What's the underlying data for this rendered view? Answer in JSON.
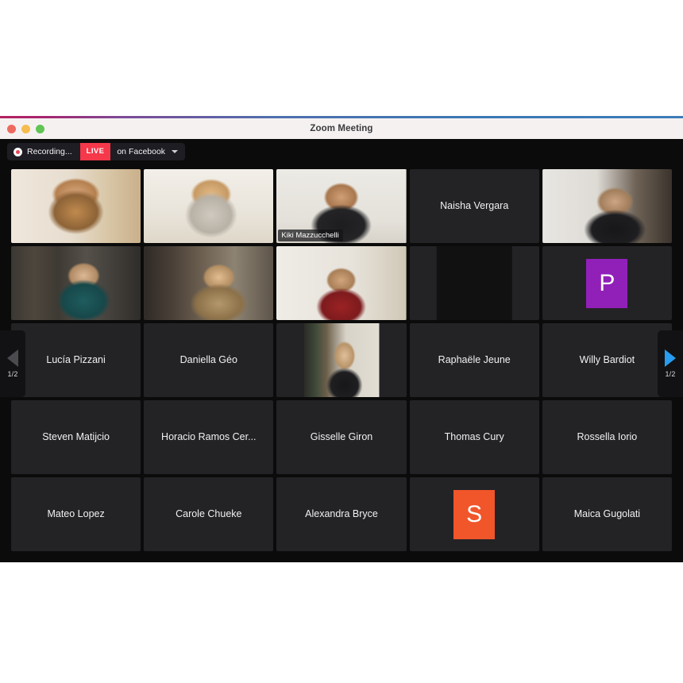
{
  "window": {
    "title": "Zoom Meeting",
    "traffic_lights": [
      "close-button",
      "minimize-button",
      "maximize-button"
    ]
  },
  "toolbar": {
    "recording_label": "Recording...",
    "recording_icon": "record-dot-icon",
    "live_badge": "LIVE",
    "platform_label": "on Facebook",
    "dropdown_icon": "chevron-down-icon"
  },
  "nav": {
    "prev_icon": "triangle-left-icon",
    "next_icon": "triangle-right-icon",
    "prev_count": "1/2",
    "next_count": "1/2",
    "prev_active": false,
    "next_active": true
  },
  "colors": {
    "live_red": "#f5384a",
    "speaking_border": "#c9e265",
    "avatar_purple": "#9020b8",
    "avatar_orange": "#f1552a",
    "next_arrow_blue": "#279cf0",
    "prev_arrow_gray": "#4a4a4f",
    "window_background": "#0b0b0b",
    "tile_background": "#232326"
  },
  "grid": {
    "columns": 5,
    "rows": 5,
    "tiles": [
      {
        "id": "t1",
        "kind": "video",
        "name": "",
        "label_visible": false,
        "speaking": false,
        "inset": false,
        "art": "woman-yellow-top-window"
      },
      {
        "id": "t2",
        "kind": "video",
        "name": "",
        "label_visible": false,
        "speaking": false,
        "inset": false,
        "art": "blonde-woman-hand-on-cheek"
      },
      {
        "id": "t3",
        "kind": "video",
        "name": "Kiki Mazzucchelli",
        "label_visible": true,
        "speaking": true,
        "inset": false,
        "art": "woman-black-top-white-wall"
      },
      {
        "id": "t4",
        "kind": "name",
        "name": "Naisha Vergara",
        "label_visible": true,
        "speaking": false,
        "inset": false,
        "art": ""
      },
      {
        "id": "t5",
        "kind": "video",
        "name": "",
        "label_visible": false,
        "speaking": false,
        "inset": false,
        "art": "person-with-headphones"
      },
      {
        "id": "t6",
        "kind": "video",
        "name": "",
        "label_visible": false,
        "speaking": false,
        "inset": false,
        "art": "woman-bookshelf-teal"
      },
      {
        "id": "t7",
        "kind": "video",
        "name": "",
        "label_visible": false,
        "speaking": false,
        "inset": false,
        "art": "man-glasses-library"
      },
      {
        "id": "t8",
        "kind": "video",
        "name": "",
        "label_visible": false,
        "speaking": false,
        "inset": false,
        "art": "woman-red-turtleneck"
      },
      {
        "id": "t9",
        "kind": "photo",
        "name": "",
        "label_visible": false,
        "speaking": false,
        "inset": true,
        "art": "sunset-yoga-silhouette"
      },
      {
        "id": "t10",
        "kind": "avatar",
        "name": "",
        "label_visible": false,
        "speaking": false,
        "inset": false,
        "art": "",
        "initial": "P",
        "avatar_color": "#9020b8"
      },
      {
        "id": "t11",
        "kind": "name",
        "name": "Lucía Pizzani",
        "label_visible": true,
        "speaking": false,
        "inset": false,
        "art": ""
      },
      {
        "id": "t12",
        "kind": "name",
        "name": "Daniella Géo",
        "label_visible": true,
        "speaking": false,
        "inset": false,
        "art": ""
      },
      {
        "id": "t13",
        "kind": "video",
        "name": "",
        "label_visible": false,
        "speaking": false,
        "inset": true,
        "art": "person-glasses-bookshelf"
      },
      {
        "id": "t14",
        "kind": "name",
        "name": "Raphaële Jeune",
        "label_visible": true,
        "speaking": false,
        "inset": false,
        "art": ""
      },
      {
        "id": "t15",
        "kind": "name",
        "name": "Willy Bardiot",
        "label_visible": true,
        "speaking": false,
        "inset": false,
        "art": ""
      },
      {
        "id": "t16",
        "kind": "name",
        "name": "Steven Matijcio",
        "label_visible": true,
        "speaking": false,
        "inset": false,
        "art": ""
      },
      {
        "id": "t17",
        "kind": "name",
        "name": "Horacio Ramos Cer...",
        "label_visible": true,
        "speaking": false,
        "inset": false,
        "art": ""
      },
      {
        "id": "t18",
        "kind": "name",
        "name": "Gisselle Giron",
        "label_visible": true,
        "speaking": false,
        "inset": false,
        "art": ""
      },
      {
        "id": "t19",
        "kind": "name",
        "name": "Thomas Cury",
        "label_visible": true,
        "speaking": false,
        "inset": false,
        "art": ""
      },
      {
        "id": "t20",
        "kind": "name",
        "name": "Rossella Iorio",
        "label_visible": true,
        "speaking": false,
        "inset": false,
        "art": ""
      },
      {
        "id": "t21",
        "kind": "name",
        "name": "Mateo Lopez",
        "label_visible": true,
        "speaking": false,
        "inset": false,
        "art": ""
      },
      {
        "id": "t22",
        "kind": "name",
        "name": "Carole Chueke",
        "label_visible": true,
        "speaking": false,
        "inset": false,
        "art": ""
      },
      {
        "id": "t23",
        "kind": "name",
        "name": "Alexandra Bryce",
        "label_visible": true,
        "speaking": false,
        "inset": false,
        "art": ""
      },
      {
        "id": "t24",
        "kind": "avatar",
        "name": "",
        "label_visible": false,
        "speaking": false,
        "inset": false,
        "art": "",
        "initial": "S",
        "avatar_color": "#f1552a"
      },
      {
        "id": "t25",
        "kind": "name",
        "name": "Maica Gugolati",
        "label_visible": true,
        "speaking": false,
        "inset": false,
        "art": ""
      }
    ]
  }
}
